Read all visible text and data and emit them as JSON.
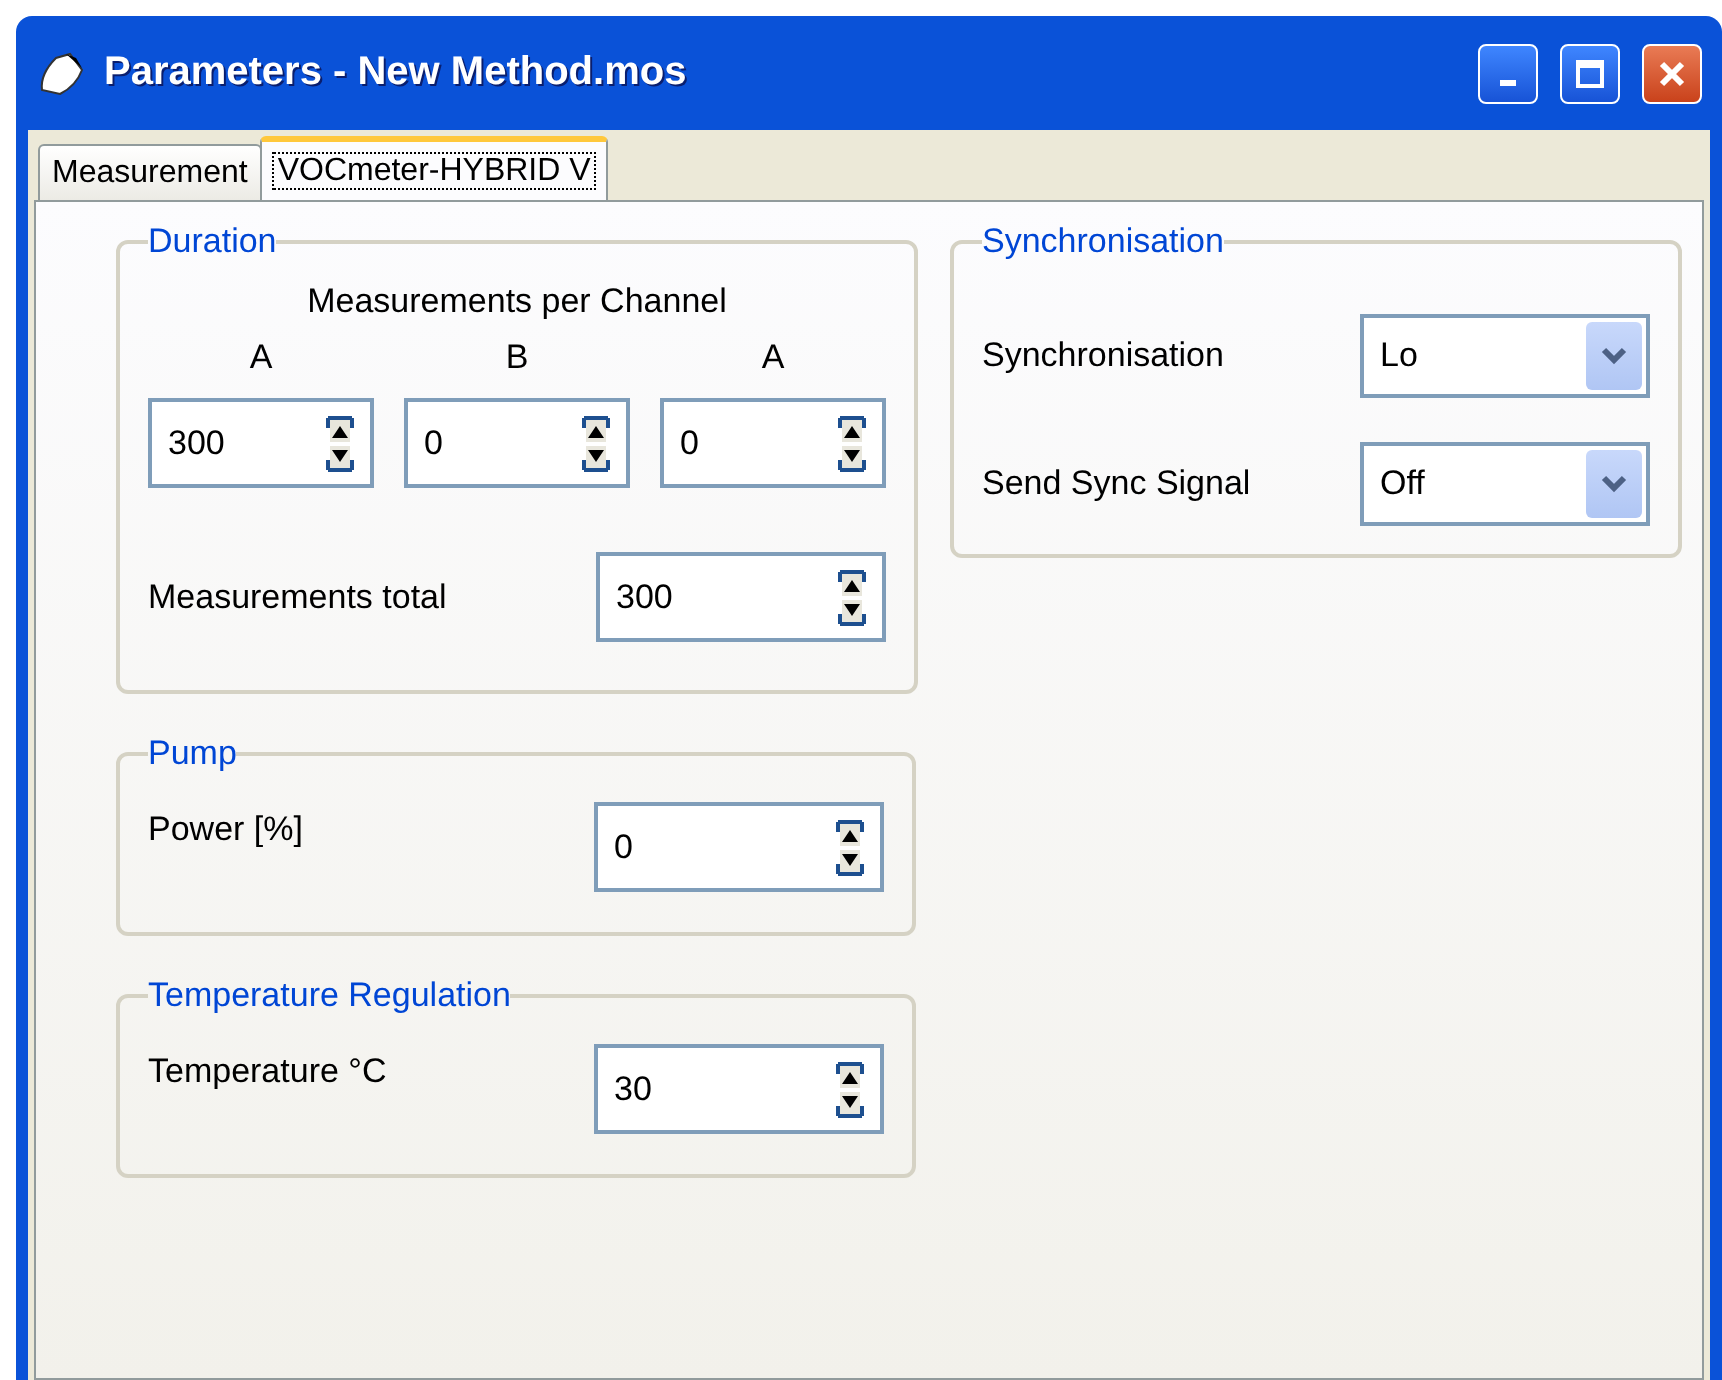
{
  "window": {
    "title": "Parameters - New Method.mos"
  },
  "tabs": [
    {
      "label": "Measurement",
      "selected": false
    },
    {
      "label": "VOCmeter-HYBRID V",
      "selected": true
    }
  ],
  "duration": {
    "title": "Duration",
    "heading": "Measurements per Channel",
    "channels": [
      {
        "label": "A",
        "value": "300"
      },
      {
        "label": "B",
        "value": "0"
      },
      {
        "label": "A",
        "value": "0"
      }
    ],
    "total": {
      "label": "Measurements total",
      "value": "300"
    }
  },
  "pump": {
    "title": "Pump",
    "fields": [
      {
        "label": "Power [%]",
        "value": "0"
      }
    ]
  },
  "temperature": {
    "title": "Temperature Regulation",
    "fields": [
      {
        "label": "Temperature °C",
        "value": "30"
      }
    ]
  },
  "synchronisation": {
    "title": "Synchronisation",
    "fields": [
      {
        "label": "Synchronisation",
        "value": "Lo"
      },
      {
        "label": "Send Sync Signal",
        "value": "Off"
      }
    ]
  }
}
